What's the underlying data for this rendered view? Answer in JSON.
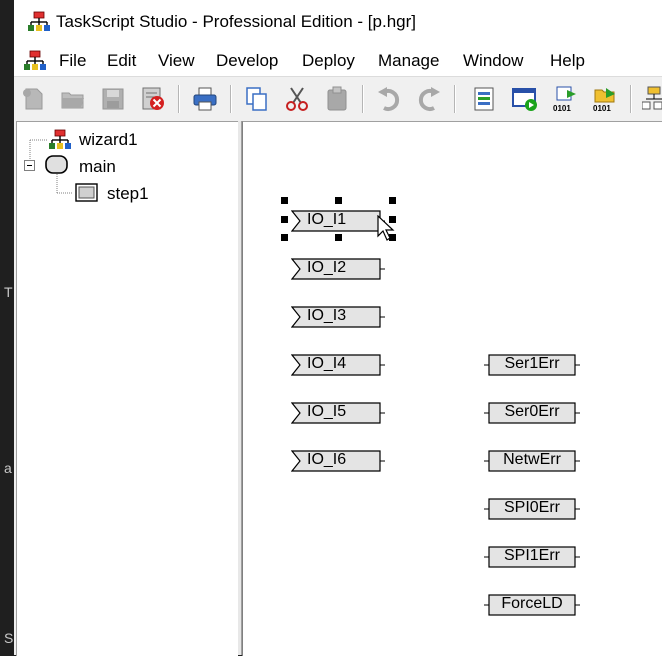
{
  "window": {
    "title": "TaskScript Studio - Professional Edition - [p.hgr]"
  },
  "menu": {
    "items": [
      "File",
      "Edit",
      "View",
      "Develop",
      "Deploy",
      "Manage",
      "Window",
      "Help"
    ]
  },
  "toolbar": {
    "buttons": [
      "new-icon",
      "open-icon",
      "save-icon",
      "close-file-icon",
      "print-icon",
      "copy-icon",
      "cut-icon",
      "paste-icon",
      "undo-icon",
      "redo-icon",
      "build-icon",
      "run-icon",
      "download-icon",
      "upload-icon",
      "network-icon"
    ]
  },
  "tree": {
    "root": "wizard1",
    "child": "main",
    "grandchild": "step1"
  },
  "canvas": {
    "inputs": [
      "IO_I1",
      "IO_I2",
      "IO_I3",
      "IO_I4",
      "IO_I5",
      "IO_I6"
    ],
    "outputs": [
      "Ser1Err",
      "Ser0Err",
      "NetwErr",
      "SPI0Err",
      "SPI1Err",
      "ForceLD"
    ],
    "selected": "IO_I1"
  },
  "desktop": {
    "glyphs": [
      "T",
      "a",
      "S"
    ]
  }
}
